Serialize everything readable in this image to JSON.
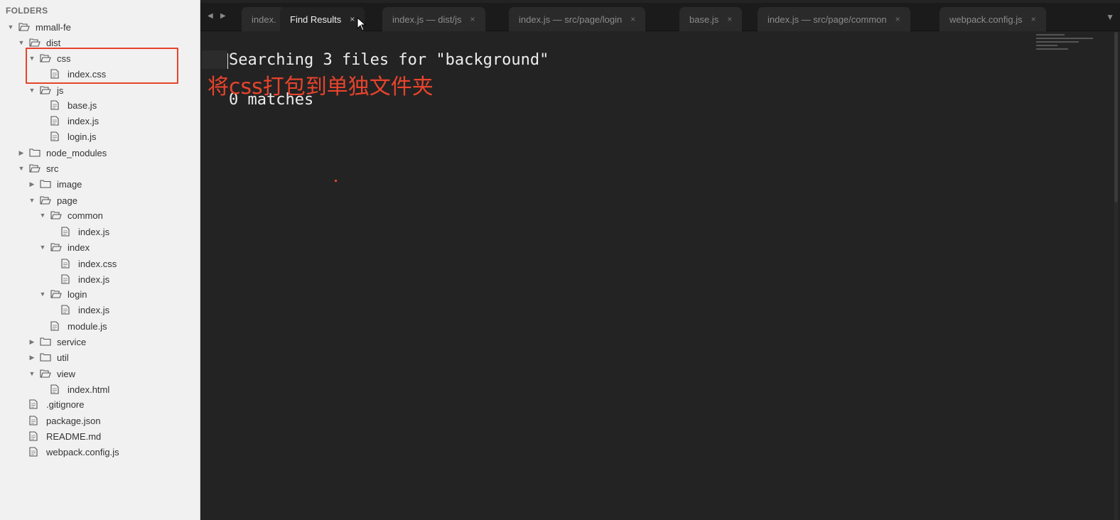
{
  "sidebar": {
    "header": "FOLDERS",
    "tree": [
      {
        "label": "mmall-fe",
        "type": "folder-open",
        "depth": 0
      },
      {
        "label": "dist",
        "type": "folder-open",
        "depth": 1
      },
      {
        "label": "css",
        "type": "folder-open",
        "depth": 2
      },
      {
        "label": "index.css",
        "type": "file",
        "depth": 3
      },
      {
        "label": "js",
        "type": "folder-open",
        "depth": 2
      },
      {
        "label": "base.js",
        "type": "file",
        "depth": 3
      },
      {
        "label": "index.js",
        "type": "file",
        "depth": 3
      },
      {
        "label": "login.js",
        "type": "file",
        "depth": 3
      },
      {
        "label": "node_modules",
        "type": "folder-closed",
        "depth": 1
      },
      {
        "label": "src",
        "type": "folder-open",
        "depth": 1
      },
      {
        "label": "image",
        "type": "folder-closed",
        "depth": 2
      },
      {
        "label": "page",
        "type": "folder-open",
        "depth": 2
      },
      {
        "label": "common",
        "type": "folder-open",
        "depth": 3
      },
      {
        "label": "index.js",
        "type": "file",
        "depth": 4
      },
      {
        "label": "index",
        "type": "folder-open",
        "depth": 3
      },
      {
        "label": "index.css",
        "type": "file",
        "depth": 4
      },
      {
        "label": "index.js",
        "type": "file",
        "depth": 4
      },
      {
        "label": "login",
        "type": "folder-open",
        "depth": 3
      },
      {
        "label": "index.js",
        "type": "file",
        "depth": 4
      },
      {
        "label": "module.js",
        "type": "file",
        "depth": 3
      },
      {
        "label": "service",
        "type": "folder-closed",
        "depth": 2
      },
      {
        "label": "util",
        "type": "folder-closed",
        "depth": 2
      },
      {
        "label": "view",
        "type": "folder-open",
        "depth": 2
      },
      {
        "label": "index.html",
        "type": "file",
        "depth": 3
      },
      {
        "label": ".gitignore",
        "type": "file",
        "depth": 1
      },
      {
        "label": "package.json",
        "type": "file",
        "depth": 1
      },
      {
        "label": "README.md",
        "type": "file",
        "depth": 1
      },
      {
        "label": "webpack.config.js",
        "type": "file",
        "depth": 1
      }
    ]
  },
  "tabs": [
    {
      "label": "index.",
      "active": false,
      "close": ""
    },
    {
      "label": "Find Results",
      "active": true,
      "close": "×"
    },
    {
      "label": "index.js — dist/js",
      "active": false,
      "close": "×"
    },
    {
      "label": "index.js — src/page/login",
      "active": false,
      "close": "×"
    },
    {
      "label": "base.js",
      "active": false,
      "close": "×"
    },
    {
      "label": "index.js — src/page/common",
      "active": false,
      "close": "×"
    },
    {
      "label": "webpack.config.js",
      "active": false,
      "close": "×"
    }
  ],
  "editor": {
    "line1": "Searching 3 files for \"background\"",
    "line2": "0 matches"
  },
  "annotation": "将css打包到单独文件夹",
  "colors": {
    "annotation_red": "#e8432c",
    "editor_bg": "#232323",
    "sidebar_bg": "#f1f1f1"
  }
}
